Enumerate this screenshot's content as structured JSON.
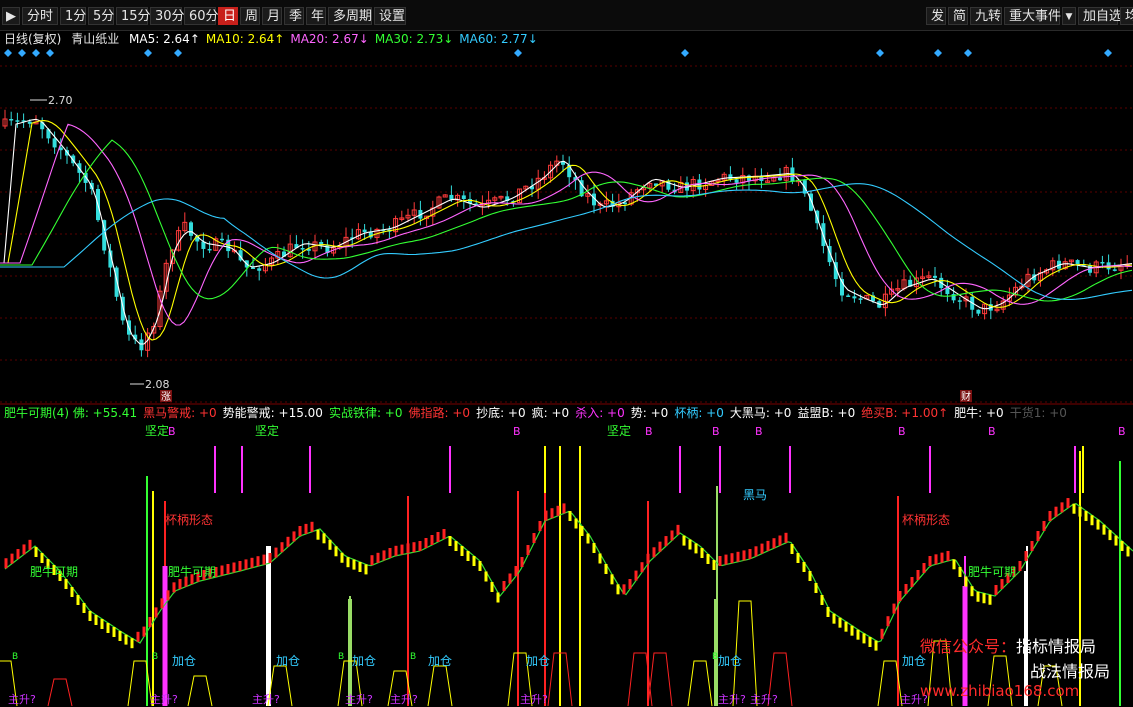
{
  "toolbar": {
    "back_icon": "arrow-left-bar-icon",
    "periods": [
      "分时",
      "1分",
      "5分",
      "15分",
      "30分",
      "60分",
      "日",
      "周",
      "月",
      "季",
      "年",
      "多周期",
      "设置"
    ],
    "active_period": "日",
    "right_buttons": [
      "发",
      "简",
      "九转",
      "重大事件",
      "加自选",
      "均线"
    ],
    "dropdown_icon": "triangle-down-icon"
  },
  "info": {
    "period": "日线(复权)",
    "stock_name": "青山纸业",
    "ma": [
      {
        "label": "MA5: 2.64↑",
        "color": "#ffffff"
      },
      {
        "label": "MA10: 2.64↑",
        "color": "#ffff00"
      },
      {
        "label": "MA20: 2.67↓",
        "color": "#ff66ff"
      },
      {
        "label": "MA30: 2.73↓",
        "color": "#33ff33"
      },
      {
        "label": "MA60: 2.77↓",
        "color": "#33ccff"
      }
    ]
  },
  "price_chart": {
    "high_label": "2.70",
    "low_label": "2.08",
    "event_markers": [
      "涨",
      "财"
    ]
  },
  "indicator": {
    "items": [
      {
        "label": "肥牛可期(4) 佛: +55.41",
        "color": "#33ff33"
      },
      {
        "label": "黑马警戒: +0",
        "color": "#ff3333"
      },
      {
        "label": "势能警戒: +15.00",
        "color": "#ffffff"
      },
      {
        "label": "实战铁律: +0",
        "color": "#33ff33"
      },
      {
        "label": "佛指路: +0",
        "color": "#ff3333"
      },
      {
        "label": "抄底: +0",
        "color": "#ffffff"
      },
      {
        "label": "疯: +0",
        "color": "#ffffff"
      },
      {
        "label": "杀入: +0",
        "color": "#ff33ff"
      },
      {
        "label": "势: +0",
        "color": "#ffffff"
      },
      {
        "label": "杯柄: +0",
        "color": "#33ccff"
      },
      {
        "label": "大黑马: +0",
        "color": "#ffffff"
      },
      {
        "label": "益盟B: +0",
        "color": "#ffffff"
      },
      {
        "label": "绝买B: +1.00↑",
        "color": "#ff3333"
      },
      {
        "label": "肥牛: +0",
        "color": "#ffffff"
      },
      {
        "label": "干货1: +0",
        "color": "#555555"
      }
    ],
    "annotations": {
      "jianding": "坚定",
      "b": "B",
      "heima": "黑马",
      "beibing": "杯柄形态",
      "feiniu": "肥牛可期",
      "jiacang": "加仓",
      "zhusheng": "主升?"
    }
  },
  "watermark": {
    "line1_prefix": "微信公众号：",
    "line1": "指标情报局",
    "line2": "战法情报局",
    "url": "www.zhibiao168.com"
  }
}
